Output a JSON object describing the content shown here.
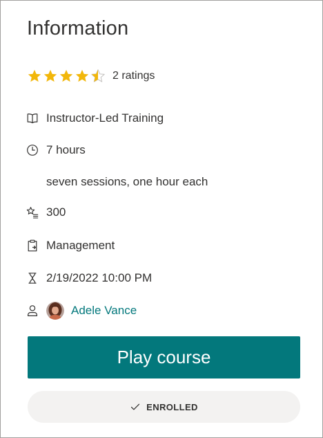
{
  "panel": {
    "title": "Information",
    "rating": {
      "value": 4.5,
      "max": 5,
      "text": "2 ratings",
      "star_color": "#f2b70a",
      "empty_star_color": "#c8c6c4"
    },
    "details": {
      "format": "Instructor-Led Training",
      "duration": "7 hours",
      "duration_note": "seven sessions, one hour each",
      "level": "300",
      "category": "Management",
      "date": "2/19/2022 10:00 PM",
      "author": "Adele Vance"
    },
    "icons": {
      "format": "book-icon",
      "duration": "clock-icon",
      "level": "star-list-icon",
      "category": "clipboard-icon",
      "date": "hourglass-icon",
      "author": "person-icon"
    },
    "actions": {
      "play_label": "Play course",
      "enrolled_label": "ENROLLED",
      "accent_color": "#03787c"
    }
  }
}
